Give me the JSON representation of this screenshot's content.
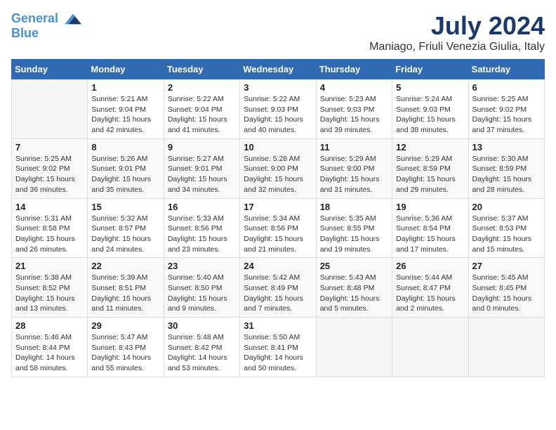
{
  "header": {
    "logo_line1": "General",
    "logo_line2": "Blue",
    "month_year": "July 2024",
    "location": "Maniago, Friuli Venezia Giulia, Italy"
  },
  "weekdays": [
    "Sunday",
    "Monday",
    "Tuesday",
    "Wednesday",
    "Thursday",
    "Friday",
    "Saturday"
  ],
  "weeks": [
    [
      {
        "day": "",
        "info": ""
      },
      {
        "day": "1",
        "info": "Sunrise: 5:21 AM\nSunset: 9:04 PM\nDaylight: 15 hours\nand 42 minutes."
      },
      {
        "day": "2",
        "info": "Sunrise: 5:22 AM\nSunset: 9:04 PM\nDaylight: 15 hours\nand 41 minutes."
      },
      {
        "day": "3",
        "info": "Sunrise: 5:22 AM\nSunset: 9:03 PM\nDaylight: 15 hours\nand 40 minutes."
      },
      {
        "day": "4",
        "info": "Sunrise: 5:23 AM\nSunset: 9:03 PM\nDaylight: 15 hours\nand 39 minutes."
      },
      {
        "day": "5",
        "info": "Sunrise: 5:24 AM\nSunset: 9:03 PM\nDaylight: 15 hours\nand 38 minutes."
      },
      {
        "day": "6",
        "info": "Sunrise: 5:25 AM\nSunset: 9:02 PM\nDaylight: 15 hours\nand 37 minutes."
      }
    ],
    [
      {
        "day": "7",
        "info": "Sunrise: 5:25 AM\nSunset: 9:02 PM\nDaylight: 15 hours\nand 36 minutes."
      },
      {
        "day": "8",
        "info": "Sunrise: 5:26 AM\nSunset: 9:01 PM\nDaylight: 15 hours\nand 35 minutes."
      },
      {
        "day": "9",
        "info": "Sunrise: 5:27 AM\nSunset: 9:01 PM\nDaylight: 15 hours\nand 34 minutes."
      },
      {
        "day": "10",
        "info": "Sunrise: 5:28 AM\nSunset: 9:00 PM\nDaylight: 15 hours\nand 32 minutes."
      },
      {
        "day": "11",
        "info": "Sunrise: 5:29 AM\nSunset: 9:00 PM\nDaylight: 15 hours\nand 31 minutes."
      },
      {
        "day": "12",
        "info": "Sunrise: 5:29 AM\nSunset: 8:59 PM\nDaylight: 15 hours\nand 29 minutes."
      },
      {
        "day": "13",
        "info": "Sunrise: 5:30 AM\nSunset: 8:59 PM\nDaylight: 15 hours\nand 28 minutes."
      }
    ],
    [
      {
        "day": "14",
        "info": "Sunrise: 5:31 AM\nSunset: 8:58 PM\nDaylight: 15 hours\nand 26 minutes."
      },
      {
        "day": "15",
        "info": "Sunrise: 5:32 AM\nSunset: 8:57 PM\nDaylight: 15 hours\nand 24 minutes."
      },
      {
        "day": "16",
        "info": "Sunrise: 5:33 AM\nSunset: 8:56 PM\nDaylight: 15 hours\nand 23 minutes."
      },
      {
        "day": "17",
        "info": "Sunrise: 5:34 AM\nSunset: 8:56 PM\nDaylight: 15 hours\nand 21 minutes."
      },
      {
        "day": "18",
        "info": "Sunrise: 5:35 AM\nSunset: 8:55 PM\nDaylight: 15 hours\nand 19 minutes."
      },
      {
        "day": "19",
        "info": "Sunrise: 5:36 AM\nSunset: 8:54 PM\nDaylight: 15 hours\nand 17 minutes."
      },
      {
        "day": "20",
        "info": "Sunrise: 5:37 AM\nSunset: 8:53 PM\nDaylight: 15 hours\nand 15 minutes."
      }
    ],
    [
      {
        "day": "21",
        "info": "Sunrise: 5:38 AM\nSunset: 8:52 PM\nDaylight: 15 hours\nand 13 minutes."
      },
      {
        "day": "22",
        "info": "Sunrise: 5:39 AM\nSunset: 8:51 PM\nDaylight: 15 hours\nand 11 minutes."
      },
      {
        "day": "23",
        "info": "Sunrise: 5:40 AM\nSunset: 8:50 PM\nDaylight: 15 hours\nand 9 minutes."
      },
      {
        "day": "24",
        "info": "Sunrise: 5:42 AM\nSunset: 8:49 PM\nDaylight: 15 hours\nand 7 minutes."
      },
      {
        "day": "25",
        "info": "Sunrise: 5:43 AM\nSunset: 8:48 PM\nDaylight: 15 hours\nand 5 minutes."
      },
      {
        "day": "26",
        "info": "Sunrise: 5:44 AM\nSunset: 8:47 PM\nDaylight: 15 hours\nand 2 minutes."
      },
      {
        "day": "27",
        "info": "Sunrise: 5:45 AM\nSunset: 8:45 PM\nDaylight: 15 hours\nand 0 minutes."
      }
    ],
    [
      {
        "day": "28",
        "info": "Sunrise: 5:46 AM\nSunset: 8:44 PM\nDaylight: 14 hours\nand 58 minutes."
      },
      {
        "day": "29",
        "info": "Sunrise: 5:47 AM\nSunset: 8:43 PM\nDaylight: 14 hours\nand 55 minutes."
      },
      {
        "day": "30",
        "info": "Sunrise: 5:48 AM\nSunset: 8:42 PM\nDaylight: 14 hours\nand 53 minutes."
      },
      {
        "day": "31",
        "info": "Sunrise: 5:50 AM\nSunset: 8:41 PM\nDaylight: 14 hours\nand 50 minutes."
      },
      {
        "day": "",
        "info": ""
      },
      {
        "day": "",
        "info": ""
      },
      {
        "day": "",
        "info": ""
      }
    ]
  ]
}
